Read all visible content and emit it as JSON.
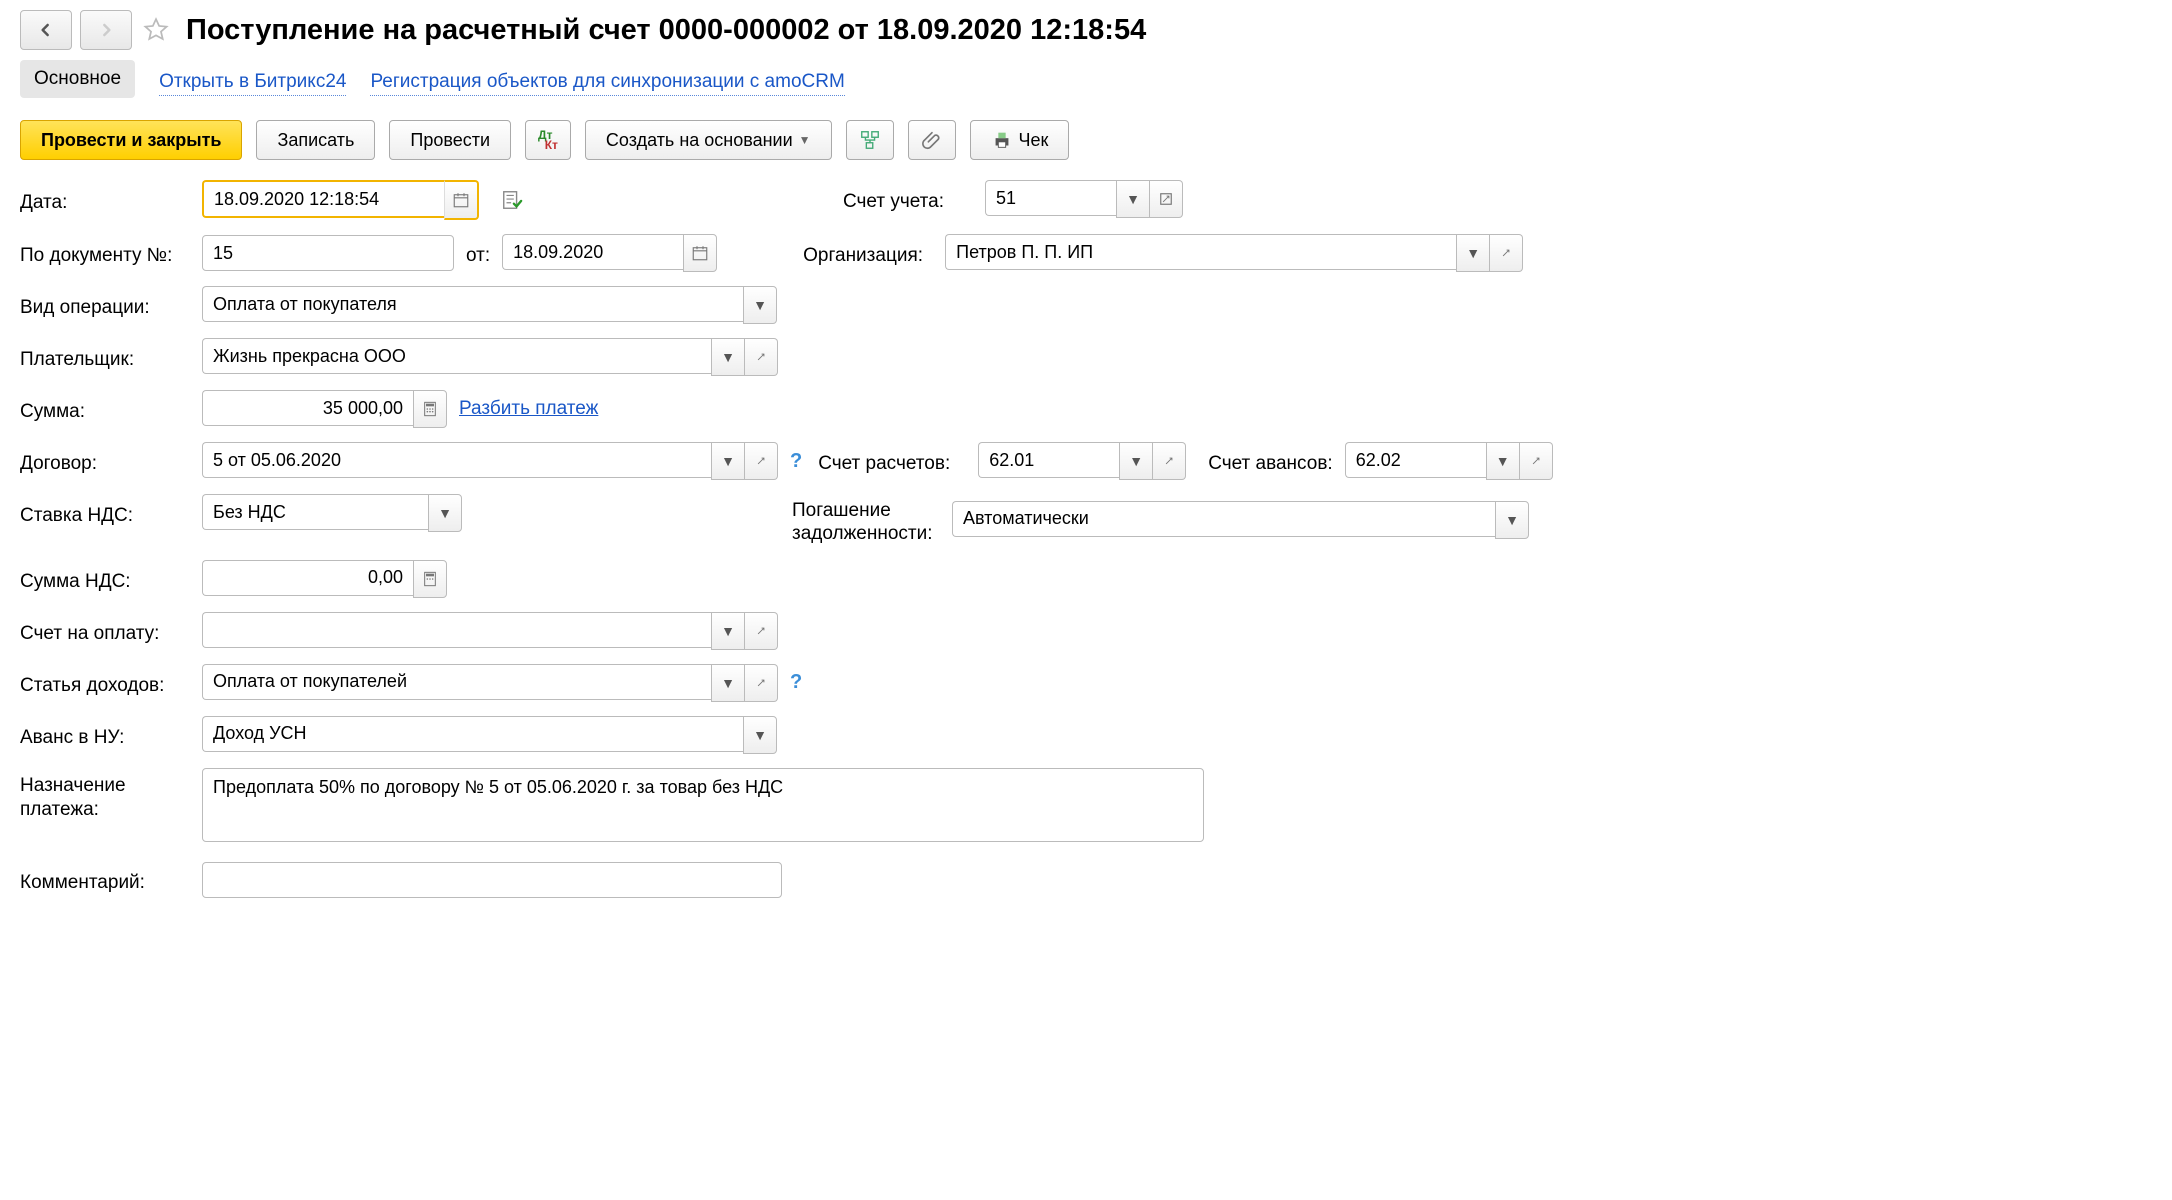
{
  "header": {
    "title": "Поступление на расчетный счет 0000-000002 от 18.09.2020 12:18:54"
  },
  "tabs": {
    "main": "Основное",
    "bitrix": "Открыть в Битрикс24",
    "amocrm": "Регистрация объектов для синхронизации с amoCRM"
  },
  "toolbar": {
    "submit_close": "Провести и закрыть",
    "save": "Записать",
    "submit": "Провести",
    "create_based": "Создать на основании",
    "cheque": "Чек"
  },
  "labels": {
    "date": "Дата:",
    "doc_no": "По документу №:",
    "from": "от:",
    "op_type": "Вид операции:",
    "payer": "Плательщик:",
    "sum": "Сумма:",
    "split": "Разбить платеж",
    "contract": "Договор:",
    "vat_rate": "Ставка НДС:",
    "vat_sum": "Сумма НДС:",
    "invoice": "Счет на оплату:",
    "income": "Статья доходов:",
    "advance_nu": "Аванс в НУ:",
    "purpose": "Назначение платежа:",
    "comment": "Комментарий:",
    "account": "Счет учета:",
    "org": "Организация:",
    "calc_account": "Счет расчетов:",
    "advance_account": "Счет авансов:",
    "debt": "Погашение задолженности:"
  },
  "fields": {
    "date": "18.09.2020 12:18:54",
    "doc_no": "15",
    "doc_date": "18.09.2020",
    "op_type": "Оплата от покупателя",
    "payer": "Жизнь прекрасна ООО",
    "sum": "35 000,00",
    "contract": "5 от 05.06.2020",
    "vat_rate": "Без НДС",
    "vat_sum": "0,00",
    "invoice": "",
    "income": "Оплата от покупателей",
    "advance_nu": "Доход УСН",
    "purpose": "Предоплата 50% по договору № 5 от 05.06.2020 г. за товар без НДС",
    "comment": "",
    "account": "51",
    "org": "Петров П. П. ИП",
    "calc_account": "62.01",
    "advance_account": "62.02",
    "debt": "Автоматически"
  }
}
